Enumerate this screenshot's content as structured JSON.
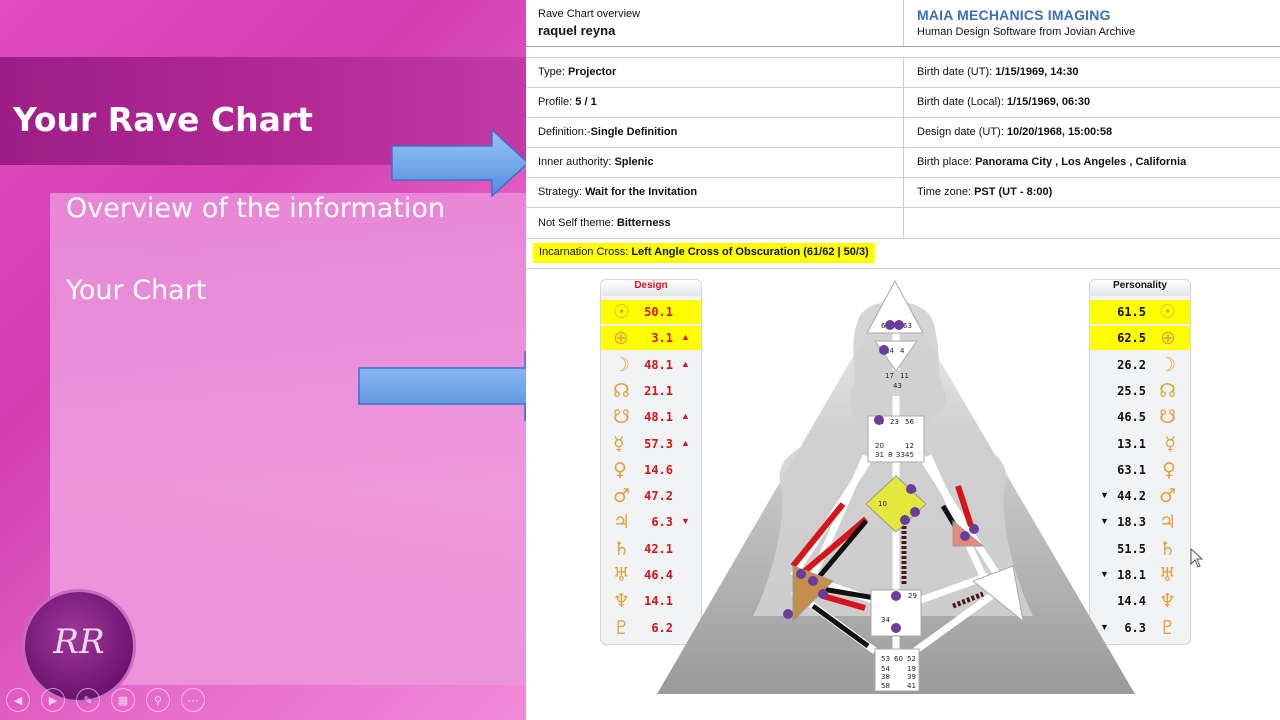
{
  "slide": {
    "title": "Your Rave Chart",
    "bullets": [
      "Overview of the information",
      "Your Chart"
    ],
    "logo_text": "RR",
    "toolbar_icons": [
      "back-icon",
      "forward-icon",
      "pen-icon",
      "slides-icon",
      "zoom-icon",
      "more-icon"
    ]
  },
  "doc": {
    "header": {
      "overview_label": "Rave Chart overview",
      "name": "raquel reyna",
      "brand": "MAIA MECHANICS IMAGING",
      "brand_sub": "Human Design Software from Jovian Archive"
    },
    "left_fields": [
      {
        "label": "Type: ",
        "value": "Projector"
      },
      {
        "label": "Profile: ",
        "value": "5 / 1"
      },
      {
        "label": "Definition:-",
        "value": "Single Definition"
      },
      {
        "label": "Inner authority: ",
        "value": "Splenic"
      },
      {
        "label": "Strategy: ",
        "value": "Wait for the Invitation"
      },
      {
        "label": "Not Self theme: ",
        "value": "Bitterness"
      }
    ],
    "right_fields": [
      {
        "label": "Birth date (UT): ",
        "value": "1/15/1969, 14:30"
      },
      {
        "label": "Birth date (Local): ",
        "value": "1/15/1969, 06:30"
      },
      {
        "label": "Design date (UT): ",
        "value": "10/20/1968, 15:00:58"
      },
      {
        "label": "Birth place: ",
        "value": "Panorama City , Los Angeles , California"
      },
      {
        "label": "Time zone: ",
        "value": "PST (UT - 8:00)"
      }
    ],
    "cross": {
      "label": "Incarnation Cross: ",
      "value": "Left Angle Cross of Obscuration (61/62 | 50/3)"
    },
    "design": {
      "title": "Design",
      "rows": [
        {
          "sym": "☉",
          "val": "50.1",
          "mark": "",
          "hl": true
        },
        {
          "sym": "⊕",
          "val": "3.1",
          "mark": "▲",
          "hl": true
        },
        {
          "sym": "☽",
          "val": "48.1",
          "mark": "▲",
          "hl": false
        },
        {
          "sym": "☊",
          "val": "21.1",
          "mark": "",
          "hl": false
        },
        {
          "sym": "☋",
          "val": "48.1",
          "mark": "▲",
          "hl": false
        },
        {
          "sym": "☿",
          "val": "57.3",
          "mark": "▲",
          "hl": false
        },
        {
          "sym": "♀",
          "val": "14.6",
          "mark": "",
          "hl": false
        },
        {
          "sym": "♂",
          "val": "47.2",
          "mark": "",
          "hl": false
        },
        {
          "sym": "♃",
          "val": "6.3",
          "mark": "▼",
          "hl": false
        },
        {
          "sym": "♄",
          "val": "42.1",
          "mark": "",
          "hl": false
        },
        {
          "sym": "♅",
          "val": "46.4",
          "mark": "",
          "hl": false
        },
        {
          "sym": "♆",
          "val": "14.1",
          "mark": "",
          "hl": false
        },
        {
          "sym": "♇",
          "val": "6.2",
          "mark": "",
          "hl": false
        }
      ]
    },
    "personality": {
      "title": "Personality",
      "rows": [
        {
          "sym": "☉",
          "val": "61.5",
          "mark": "",
          "hl": true
        },
        {
          "sym": "⊕",
          "val": "62.5",
          "mark": "",
          "hl": true
        },
        {
          "sym": "☽",
          "val": "26.2",
          "mark": "",
          "hl": false
        },
        {
          "sym": "☊",
          "val": "25.5",
          "mark": "",
          "hl": false
        },
        {
          "sym": "☋",
          "val": "46.5",
          "mark": "",
          "hl": false
        },
        {
          "sym": "☿",
          "val": "13.1",
          "mark": "",
          "hl": false
        },
        {
          "sym": "♀",
          "val": "63.1",
          "mark": "",
          "hl": false
        },
        {
          "sym": "♂",
          "val": "44.2",
          "mark": "▼",
          "hl": false
        },
        {
          "sym": "♃",
          "val": "18.3",
          "mark": "▼",
          "hl": false
        },
        {
          "sym": "♄",
          "val": "51.5",
          "mark": "",
          "hl": false
        },
        {
          "sym": "♅",
          "val": "18.1",
          "mark": "▼",
          "hl": false
        },
        {
          "sym": "♆",
          "val": "14.4",
          "mark": "",
          "hl": false
        },
        {
          "sym": "♇",
          "val": "6.3",
          "mark": "▼",
          "hl": false
        }
      ]
    },
    "colors": {
      "design_red": "#d7141a",
      "personality_black": "#111111",
      "highlight": "#ffff00",
      "gate_purple": "#6a3d9a"
    }
  }
}
